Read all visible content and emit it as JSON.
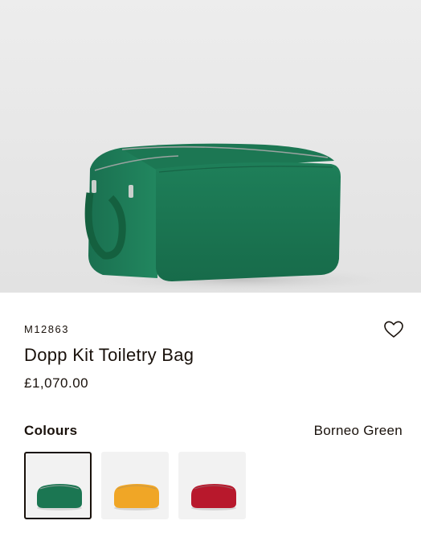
{
  "product": {
    "sku": "M12863",
    "name": "Dopp Kit Toiletry Bag",
    "price": "£1,070.00",
    "image_color": "#1f7a55"
  },
  "colours": {
    "label": "Colours",
    "selected_name": "Borneo Green",
    "swatches": [
      {
        "color": "#1b7652",
        "selected": true
      },
      {
        "color": "#f0a626",
        "selected": false
      },
      {
        "color": "#b8182c",
        "selected": false
      }
    ]
  },
  "icons": {
    "wishlist": "heart-icon"
  }
}
